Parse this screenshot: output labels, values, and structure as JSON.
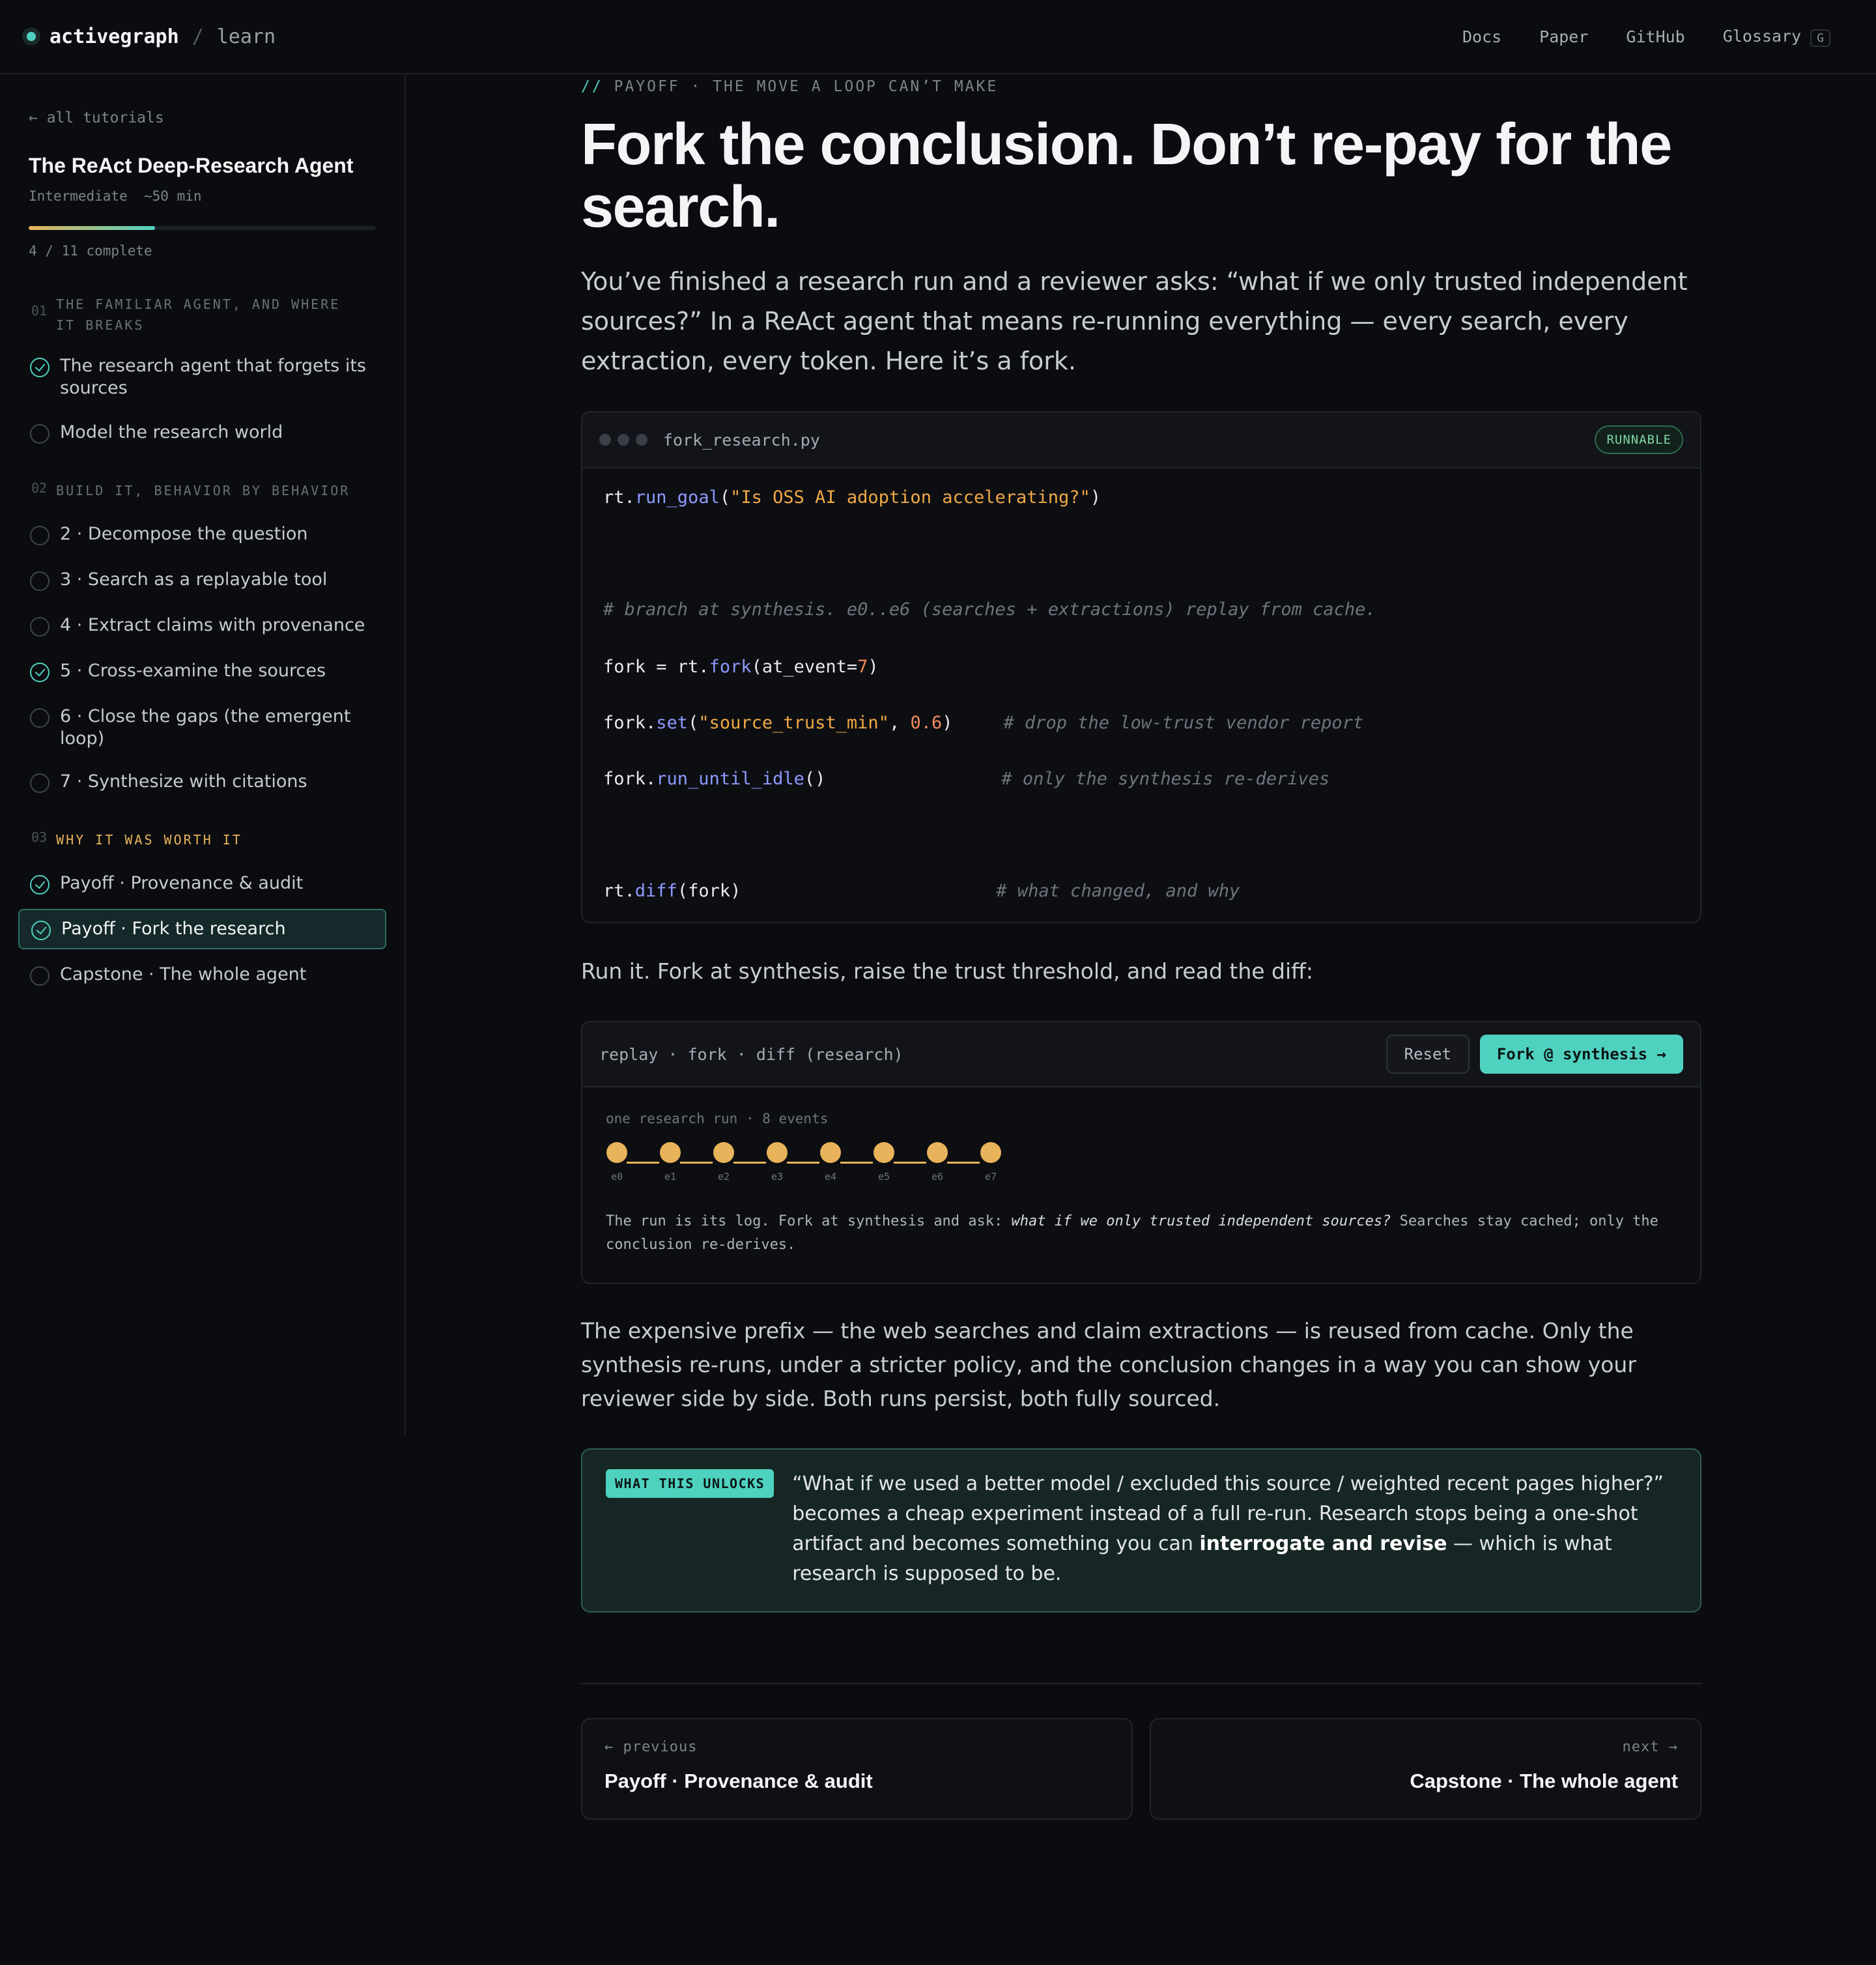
{
  "header": {
    "brand": "activegraph",
    "separator": "/",
    "section": "learn",
    "nav": [
      "Docs",
      "Paper",
      "GitHub",
      "Glossary"
    ],
    "glossary_key": "G"
  },
  "sidebar": {
    "back_link": "← all tutorials",
    "course_title": "The ReAct Deep-Research Agent",
    "course_meta": "Intermediate  ~50 min",
    "progress": {
      "completed": 4,
      "total": 11,
      "text": "4 / 11 complete"
    },
    "sections": [
      {
        "num": "01",
        "label": "THE FAMILIAR AGENT, AND WHERE IT BREAKS",
        "lessons": [
          {
            "label": "The research agent that forgets its sources",
            "done": true
          },
          {
            "label": "Model the research world",
            "done": false
          }
        ]
      },
      {
        "num": "02",
        "label": "BUILD IT, BEHAVIOR BY BEHAVIOR",
        "lessons": [
          {
            "label": "2 · Decompose the question",
            "done": false
          },
          {
            "label": "3 · Search as a replayable tool",
            "done": false
          },
          {
            "label": "4 · Extract claims with provenance",
            "done": false
          },
          {
            "label": "5 · Cross-examine the sources",
            "done": true
          },
          {
            "label": "6 · Close the gaps (the emergent loop)",
            "done": false
          },
          {
            "label": "7 · Synthesize with citations",
            "done": false
          }
        ]
      },
      {
        "num": "03",
        "label": "WHY IT WAS WORTH IT",
        "lessons": [
          {
            "label": "Payoff · Provenance & audit",
            "done": true
          },
          {
            "label": "Payoff · Fork the research",
            "done": true,
            "current": true
          },
          {
            "label": "Capstone · The whole agent",
            "done": false
          }
        ]
      }
    ]
  },
  "main": {
    "eyebrow_prefix": "//",
    "eyebrow": "PAYOFF · THE MOVE A LOOP CAN’T MAKE",
    "title": "Fork the conclusion. Don’t re-pay for the search.",
    "lede": "You’ve finished a research run and a reviewer asks: “what if we only trusted independent sources?” In a ReAct agent that means re-running everything — every search, every extraction, every token. Here it’s a fork.",
    "code": {
      "filename": "fork_research.py",
      "badge": "RUNNABLE",
      "lines": {
        "l1_obj": "rt.",
        "l1_fn": "run_goal",
        "l1_open": "(",
        "l1_str": "\"Is OSS AI adoption accelerating?\"",
        "l1_close": ")",
        "l2_comment": "# branch at synthesis. e0..e6 (searches + extractions) replay from cache.",
        "l3_a": "fork = rt.",
        "l3_fn": "fork",
        "l3_b": "(at_event=",
        "l3_num": "7",
        "l3_c": ")",
        "l4_a": "fork.",
        "l4_fn": "set",
        "l4_b": "(",
        "l4_str": "\"source_trust_min\"",
        "l4_c": ", ",
        "l4_num": "0.6",
        "l4_d": ")",
        "l4_comment": "# drop the low-trust vendor report",
        "l5_a": "fork.",
        "l5_fn": "run_until_idle",
        "l5_b": "()",
        "l5_comment": "# only the synthesis re-derives",
        "l6_a": "rt.",
        "l6_fn": "diff",
        "l6_b": "(fork)",
        "l6_comment": "# what changed, and why"
      }
    },
    "run_it": "Run it. Fork at synthesis, raise the trust threshold, and read the diff:",
    "demo": {
      "title": "replay · fork · diff (research)",
      "reset_label": "Reset",
      "fork_label": "Fork @ synthesis →",
      "caption": "one research run · 8 events",
      "events": [
        "e0",
        "e1",
        "e2",
        "e3",
        "e4",
        "e5",
        "e6",
        "e7"
      ],
      "text_a": "The run is its log. Fork at synthesis and ask: ",
      "text_em": "what if we only trusted independent sources?",
      "text_b": " Searches stay cached; only the conclusion re-derives."
    },
    "reuse": "The expensive prefix — the web searches and claim extractions — is reused from cache. Only the synthesis re-runs, under a stricter policy, and the conclusion changes in a way you can show your reviewer side by side. Both runs persist, both fully sourced.",
    "unlock": {
      "badge": "WHAT THIS UNLOCKS",
      "text_a": "“What if we used a better model / excluded this source / weighted recent pages higher?” becomes a cheap experiment instead of a full re-run. Research stops being a one-shot artifact and becomes something you can ",
      "text_bold": "interrogate and revise",
      "text_b": " — which is what research is supposed to be."
    },
    "pager": {
      "prev_dir": "← previous",
      "prev_title": "Payoff · Provenance & audit",
      "next_dir": "next →",
      "next_title": "Capstone · The whole agent"
    }
  },
  "colors": {
    "accent": "#4fd1c0",
    "event": "#e8b35a",
    "background": "#0b0c0f"
  }
}
